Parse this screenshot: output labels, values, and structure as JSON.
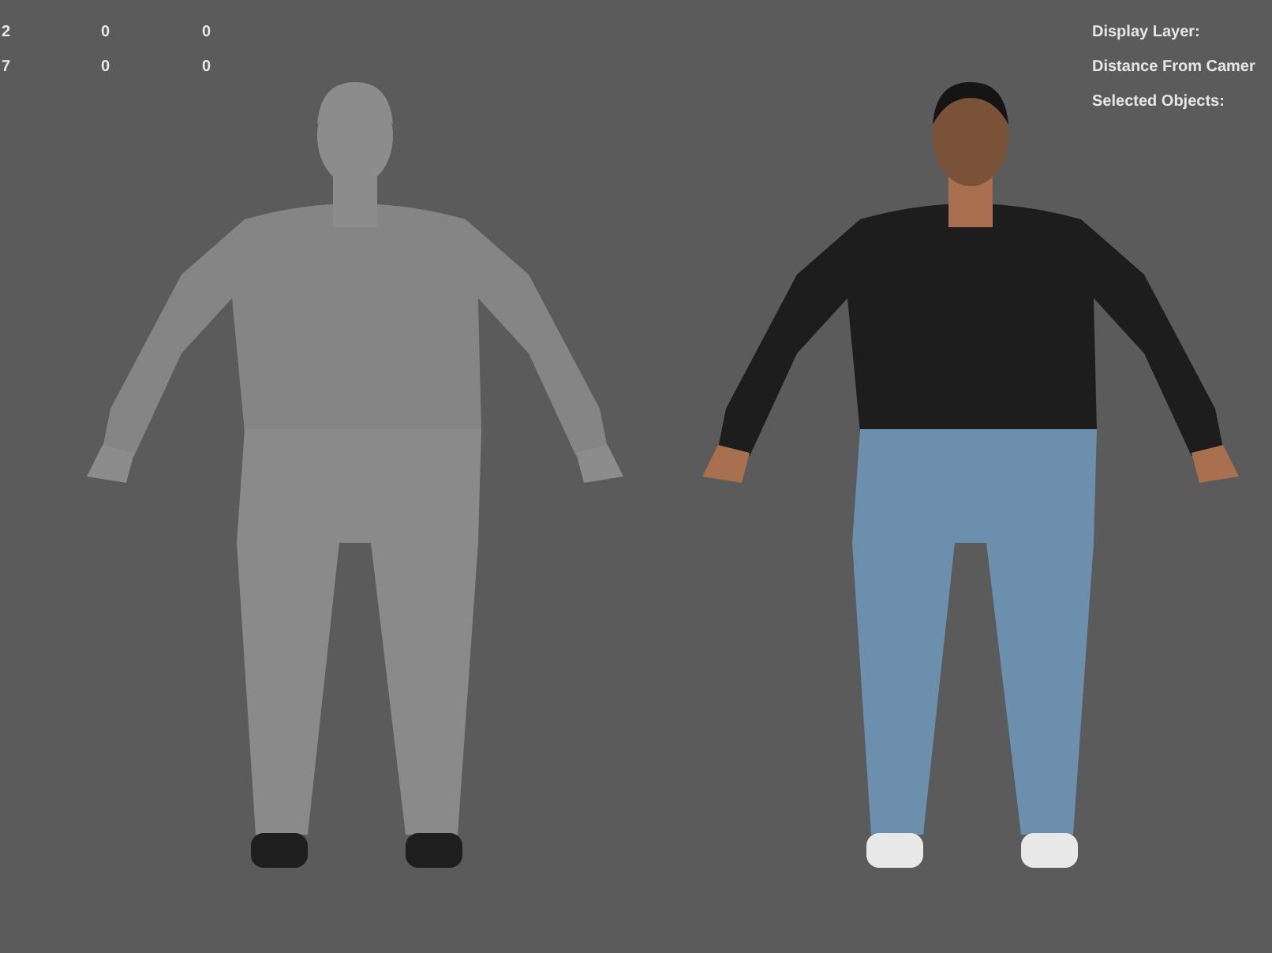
{
  "hud_left": {
    "rows": [
      {
        "column_1": "2",
        "column_2": "0",
        "column_3": "0"
      },
      {
        "column_1": "7",
        "column_2": "0",
        "column_3": "0"
      }
    ]
  },
  "hud_right": {
    "labels": [
      "Display Layer:",
      "Distance From Camer",
      "Selected Objects:"
    ]
  },
  "viewport": {
    "models": [
      {
        "kind": "untextured"
      },
      {
        "kind": "textured"
      }
    ]
  }
}
